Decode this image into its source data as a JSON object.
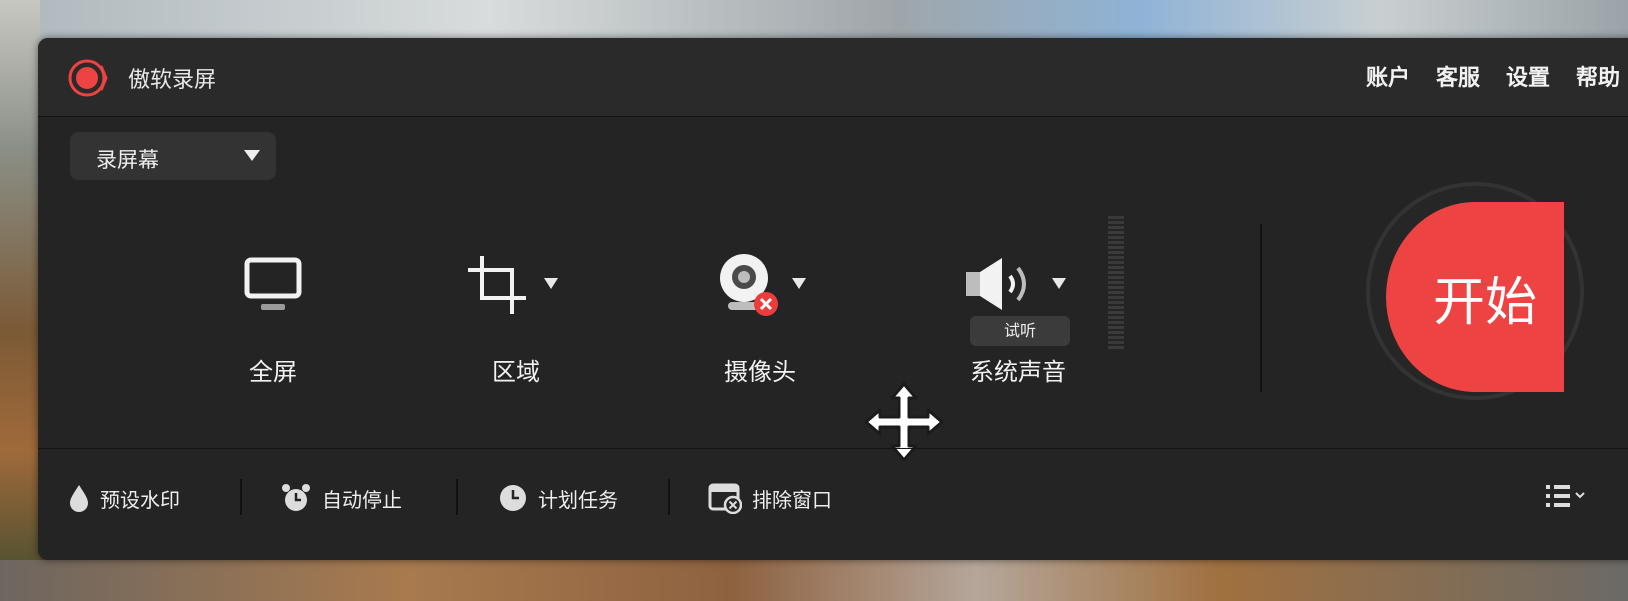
{
  "app": {
    "name": "傲软录屏",
    "accent_color": "#ee4343"
  },
  "top_nav": [
    "账户",
    "客服",
    "设置",
    "帮助"
  ],
  "mode_select": {
    "value": "录屏幕"
  },
  "options": [
    {
      "label": "全屏",
      "icon": "monitor-icon"
    },
    {
      "label": "区域",
      "icon": "crop-icon"
    },
    {
      "label": "摄像头",
      "icon": "webcam-icon"
    },
    {
      "label": "系统声音",
      "icon": "speaker-icon"
    }
  ],
  "listen_button": "试听",
  "start_button": "开始",
  "bottom_tools": [
    {
      "label": "预设水印",
      "icon": "watermark-drop-icon"
    },
    {
      "label": "自动停止",
      "icon": "alarm-clock-icon"
    },
    {
      "label": "计划任务",
      "icon": "clock-icon"
    },
    {
      "label": "排除窗口",
      "icon": "exclude-window-icon"
    }
  ]
}
